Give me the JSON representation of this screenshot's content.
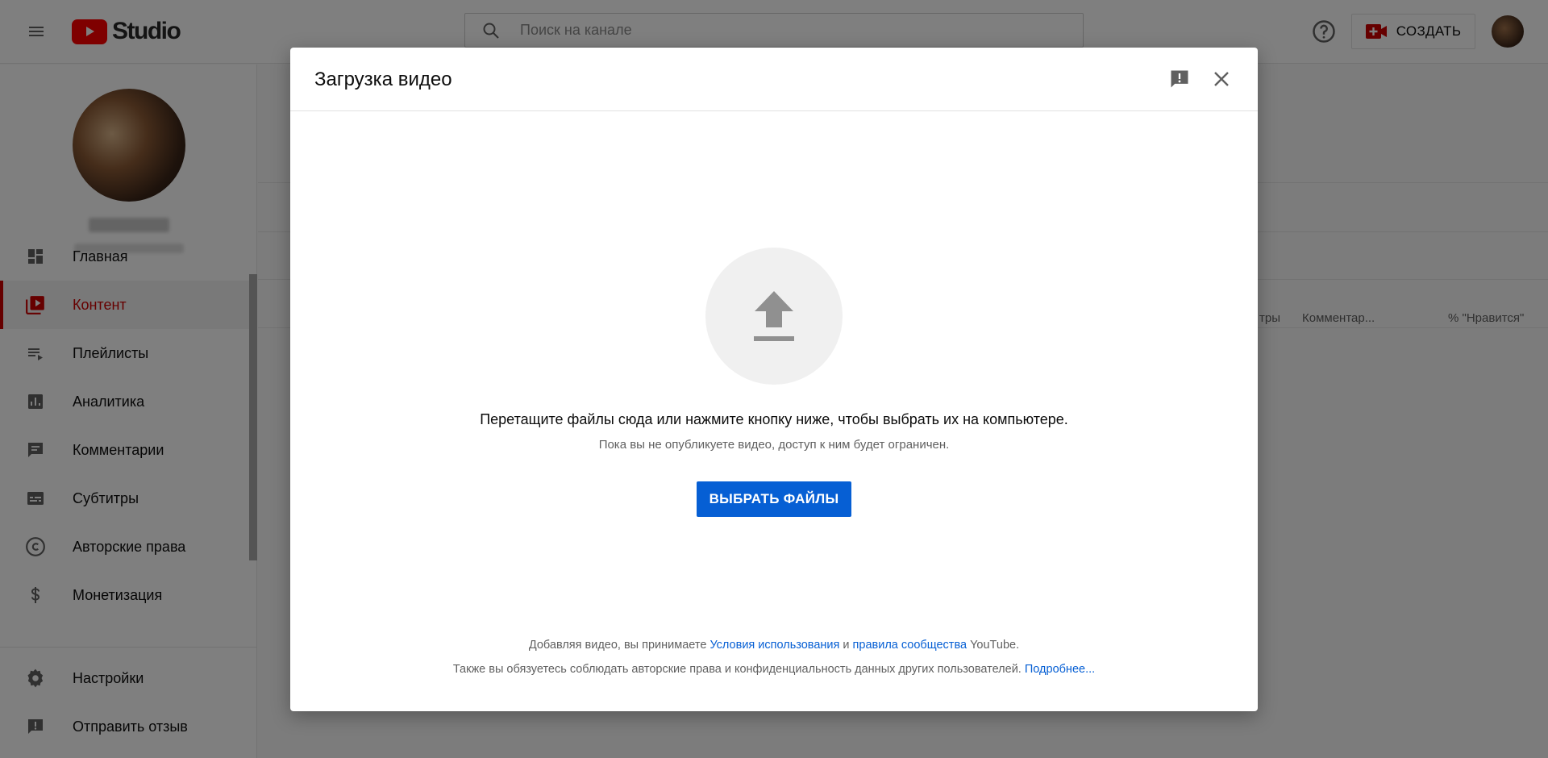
{
  "header": {
    "logo_text": "Studio",
    "search_placeholder": "Поиск на канале",
    "create_label": "СОЗДАТЬ"
  },
  "sidebar": {
    "items": [
      {
        "label": "Главная",
        "icon": "dashboard-icon"
      },
      {
        "label": "Контент",
        "icon": "content-icon",
        "active": true
      },
      {
        "label": "Плейлисты",
        "icon": "playlist-icon"
      },
      {
        "label": "Аналитика",
        "icon": "analytics-icon"
      },
      {
        "label": "Комментарии",
        "icon": "comments-icon"
      },
      {
        "label": "Субтитры",
        "icon": "subtitles-icon"
      },
      {
        "label": "Авторские права",
        "icon": "copyright-icon"
      },
      {
        "label": "Монетизация",
        "icon": "dollar-icon"
      }
    ],
    "bottom_items": [
      {
        "label": "Настройки",
        "icon": "gear-icon"
      },
      {
        "label": "Отправить отзыв",
        "icon": "feedback-icon"
      }
    ]
  },
  "table": {
    "columns": [
      "тры",
      "Комментар...",
      "% \"Нравится\""
    ]
  },
  "dialog": {
    "title": "Загрузка видео",
    "drop_text": "Перетащите файлы сюда или нажмите кнопку ниже, чтобы выбрать их на компьютере.",
    "limit_text": "Пока вы не опубликуете видео, доступ к ним будет ограничен.",
    "select_button": "ВЫБРАТЬ ФАЙЛЫ",
    "terms_1_prefix": "Добавляя видео, вы принимаете ",
    "terms_1_link1": "Условия использования",
    "terms_1_and": " и ",
    "terms_1_link2": "правила сообщества",
    "terms_1_suffix": " YouTube.",
    "terms_2_text": "Также вы обязуетесь соблюдать авторские права и конфиденциальность данных других пользователей. ",
    "terms_2_link": "Подробнее..."
  },
  "colors": {
    "accent": "#065fd4",
    "brand_red": "#ff0000",
    "active_red": "#cc0000"
  }
}
